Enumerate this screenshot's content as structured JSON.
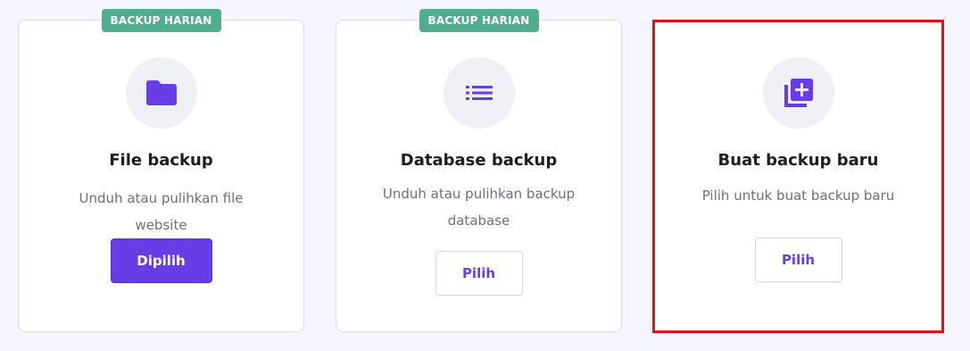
{
  "colors": {
    "accent": "#673de6",
    "badge": "#4fae8e",
    "highlight_border": "#e3101c",
    "icon_bg": "#eef0f6"
  },
  "cards": [
    {
      "badge": "BACKUP HARIAN",
      "icon": "folder-icon",
      "title": "File backup",
      "description": "Unduh atau pulihkan file website",
      "button": "Dipilih",
      "selected": true
    },
    {
      "badge": "BACKUP HARIAN",
      "icon": "list-icon",
      "title": "Database backup",
      "description": "Unduh atau pulihkan backup database",
      "button": "Pilih",
      "selected": false
    },
    {
      "icon": "add-library-icon",
      "title": "Buat backup baru",
      "description": "Pilih untuk buat backup baru",
      "button": "Pilih",
      "selected": false,
      "highlighted": true
    }
  ]
}
